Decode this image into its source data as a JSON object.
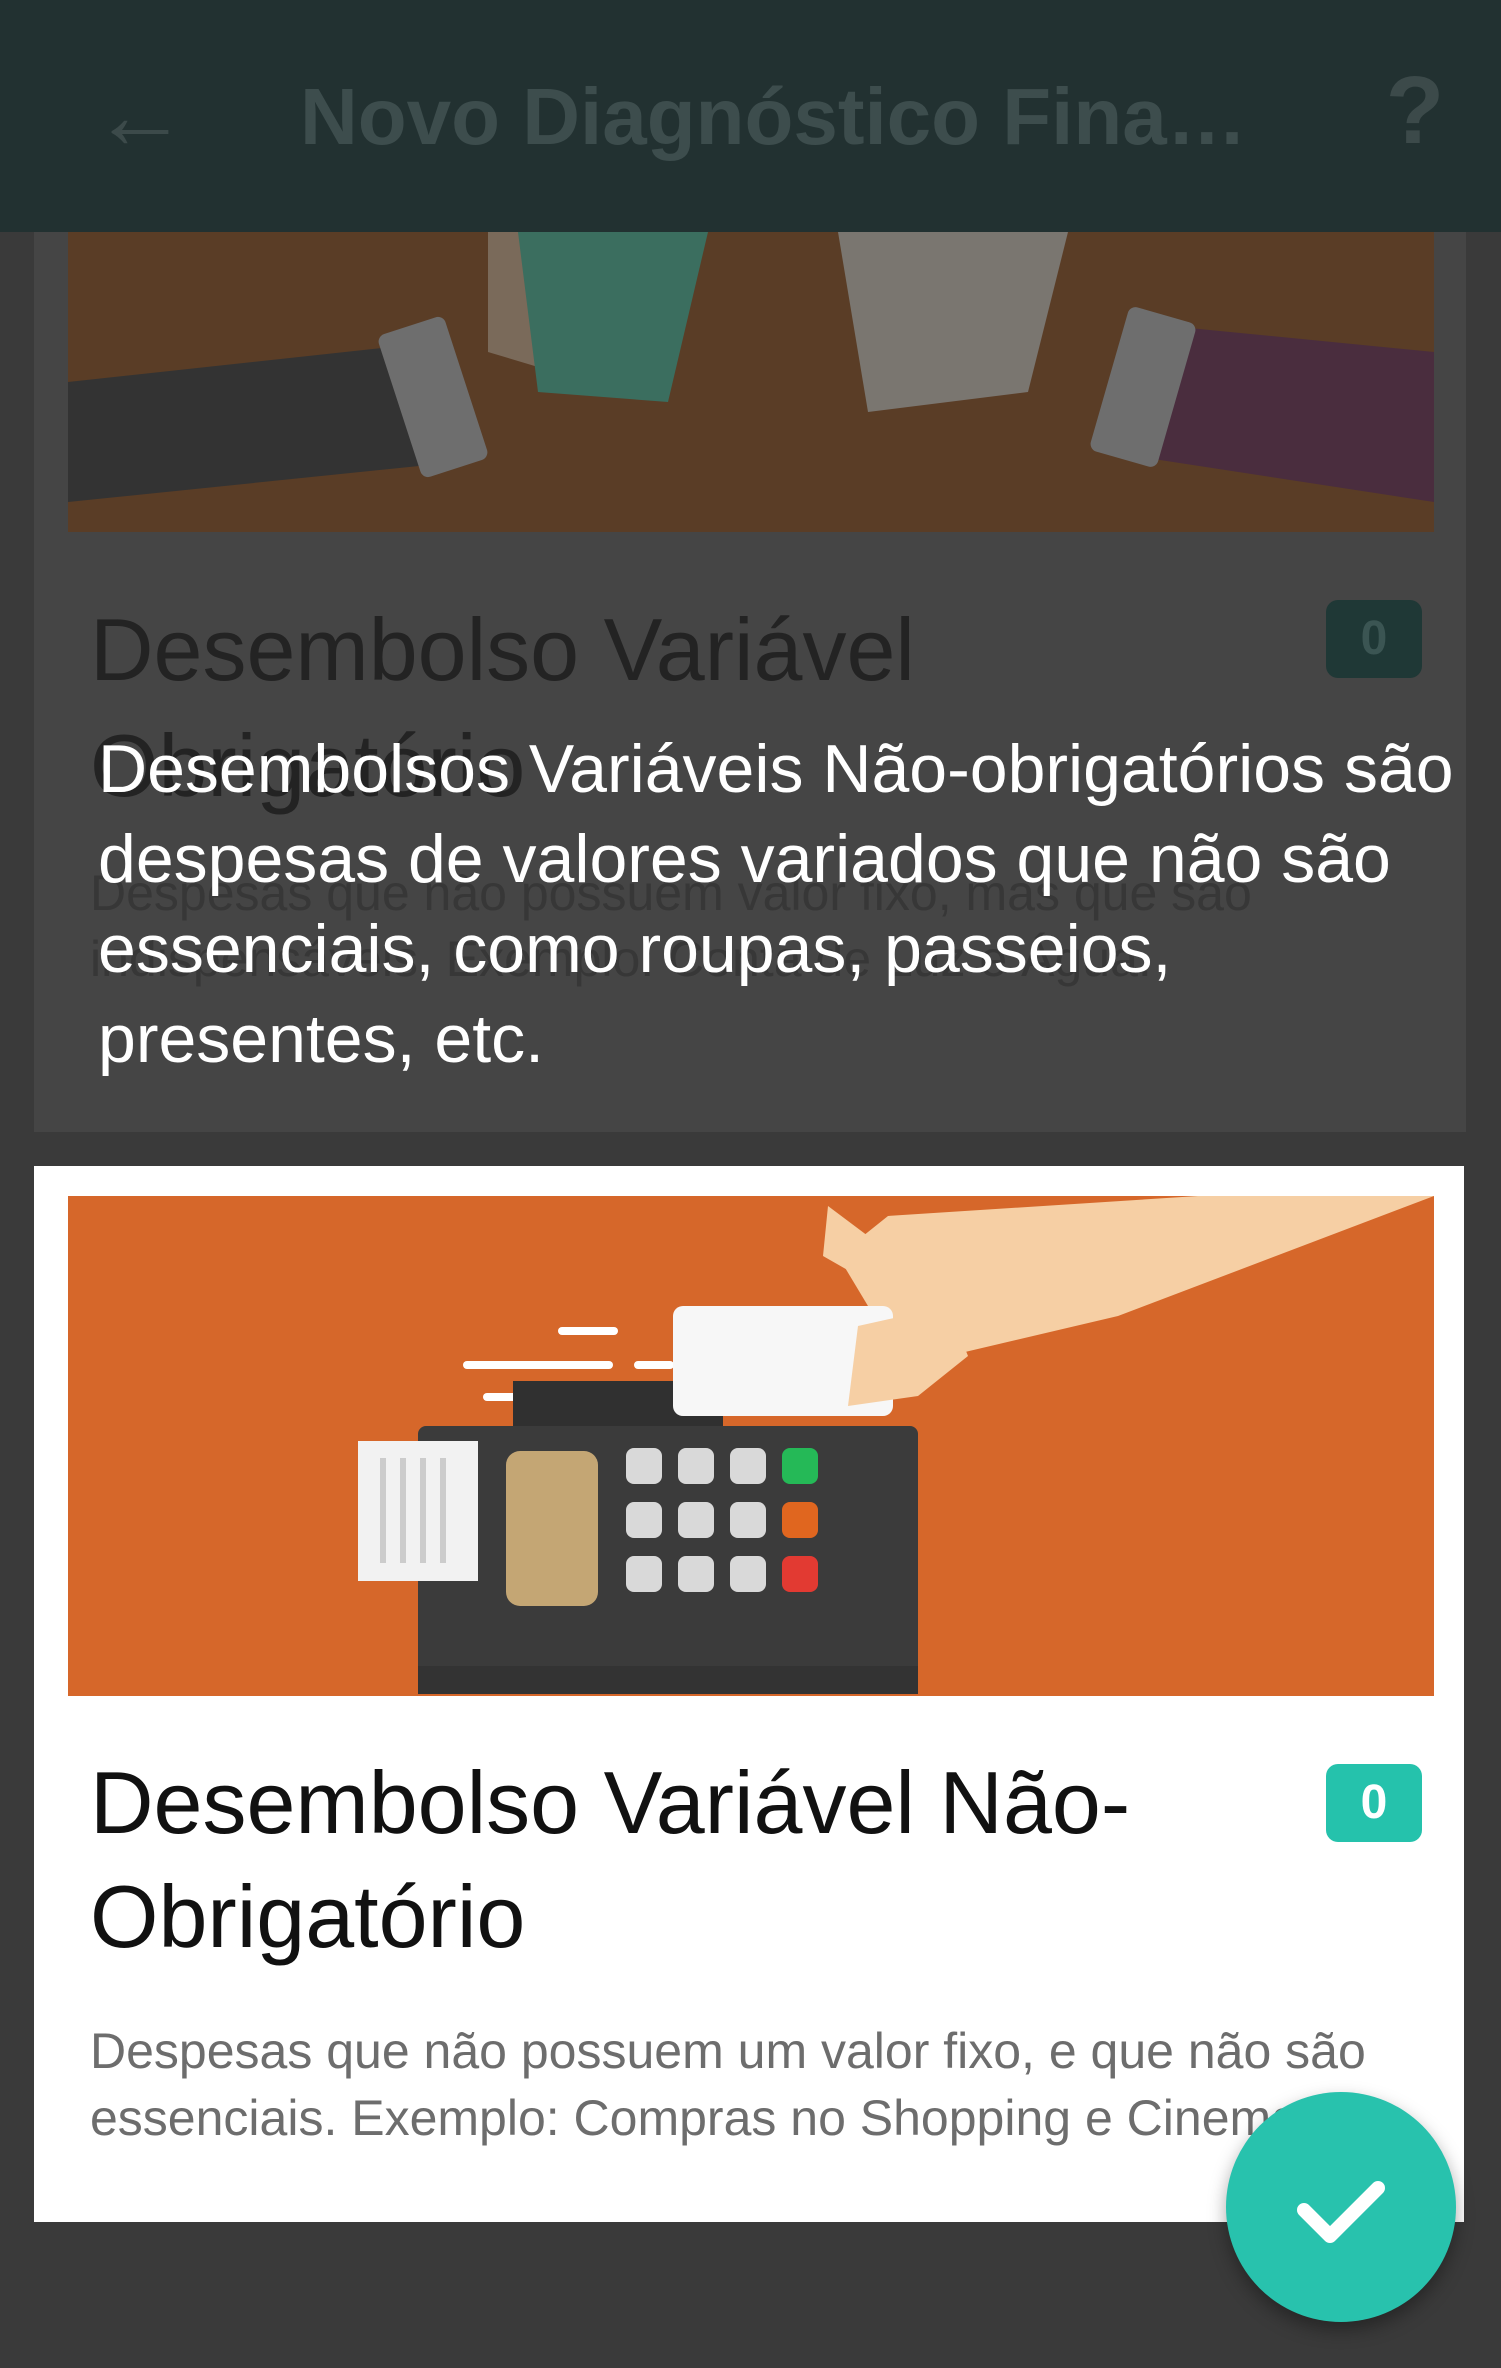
{
  "app_bar": {
    "back_icon": "arrow-left-icon",
    "title": "Novo Diagnóstico Finan...",
    "help_label": "?"
  },
  "background_card": {
    "title": "Desembolso Variável Obrigatório",
    "badge": "0",
    "description": "Despesas que não possuem valor fixo, mas que são indispensáveis. Exemplo: Conta de Luz e Água."
  },
  "tooltip": {
    "text": "Desembolsos Variáveis Não-obrigatórios são despesas de valores variados que não são essenciais, como roupas, passeios, presentes, etc."
  },
  "highlighted_card": {
    "title": "Desembolso Variável Não-Obrigatório",
    "badge": "0",
    "description": "Despesas que não possuem um valor fixo, e que não são essenciais. Exemplo: Compras no Shopping e Cinema."
  },
  "fab": {
    "icon": "check-icon"
  },
  "colors": {
    "accent": "#25c2ac",
    "card_illustration": "#d6672a",
    "app_bar_dimmed": "#223131",
    "overlay": "#3a3a3a"
  }
}
